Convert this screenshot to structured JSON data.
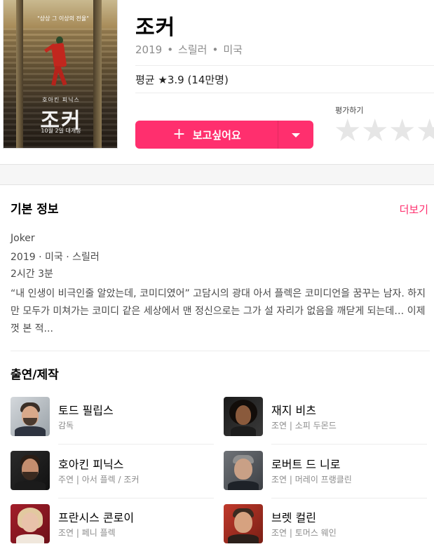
{
  "movie": {
    "title": "조커",
    "year": "2019",
    "genre": "스릴러",
    "country": "미국",
    "dot": "•",
    "average": "평균 ★3.9 (14만명)"
  },
  "poster": {
    "tagline": "\"상상 그 이상의 전율\"",
    "actor": "호아킨 피닉스",
    "title": "조커",
    "release": "10월 2일 대개봉"
  },
  "actions": {
    "want_label": "보고싶어요",
    "plus_icon": "+",
    "rate_label": "평가하기",
    "stars": [
      "★",
      "★",
      "★",
      "★"
    ]
  },
  "basic_info": {
    "title": "기본 정보",
    "more": "더보기",
    "original_title": "Joker",
    "line2": "2019 · 미국 · 스릴러",
    "runtime": "2시간 3분",
    "synopsis": "“내 인생이 비극인줄 알았는데, 코미디였어” 고담시의 광대 아서 플렉은 코미디언을 꿈꾸는 남자. 하지만 모두가 미쳐가는 코미디 같은 세상에서 맨 정신으로는 그가 설 자리가 없음을 깨닫게 되는데… 이제껏 본 적..."
  },
  "cast": {
    "title": "출연/제작",
    "people": [
      {
        "name": "토드 필립스",
        "role": "감독"
      },
      {
        "name": "재지 비츠",
        "role": "조연 | 소피 두몬드"
      },
      {
        "name": "호아킨 피닉스",
        "role": "주연 | 아서 플렉 / 조커"
      },
      {
        "name": "로버트 드 니로",
        "role": "조연 | 머레이 프랭클린"
      },
      {
        "name": "프란시스 콘로이",
        "role": "조연 | 페니 플렉"
      },
      {
        "name": "브렛 컬린",
        "role": "조연 | 토머스 웨인"
      }
    ]
  },
  "colors": {
    "accent": "#ff2f6e",
    "text_muted": "#8c8c8c",
    "star_empty": "#e6e6e6"
  }
}
